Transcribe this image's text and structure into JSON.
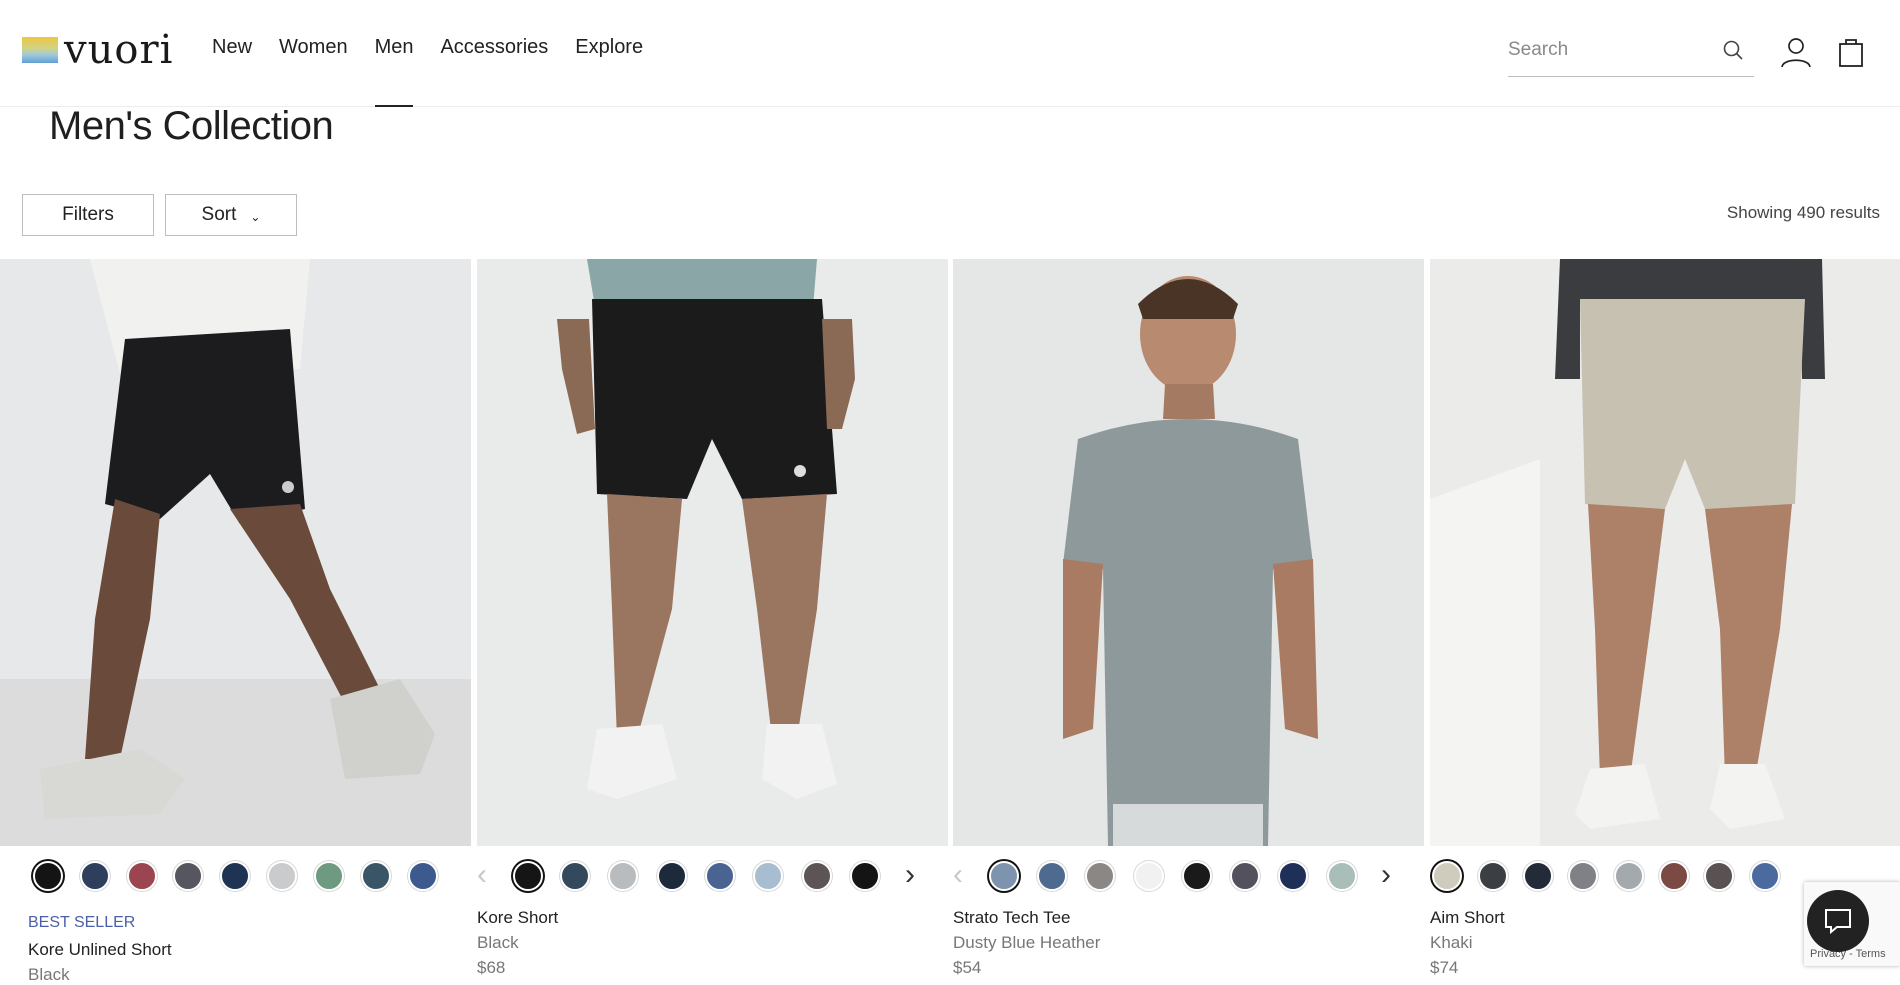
{
  "header": {
    "logo_text": "vuori",
    "nav": [
      "New",
      "Women",
      "Men",
      "Accessories",
      "Explore"
    ],
    "active_nav": "Men",
    "search_placeholder": "Search"
  },
  "page": {
    "title": "Men's Collection",
    "filters_label": "Filters",
    "sort_label": "Sort",
    "results_text": "Showing 490 results"
  },
  "products": [
    {
      "badge": "BEST SELLER",
      "name": "Kore Unlined Short",
      "color": "Black",
      "price": "",
      "swatches": [
        "#141414",
        "#2e3f5e",
        "#9a4550",
        "#55565f",
        "#1f3352",
        "#c9cbcc",
        "#6f9a82",
        "#3a5566",
        "#3c5a8e"
      ],
      "selected": 0
    },
    {
      "badge": "",
      "name": "Kore Short",
      "color": "Black",
      "price": "$68",
      "swatches": [
        "#151515",
        "#34495c",
        "#b9bcbf",
        "#1d2a3c",
        "#4a6491",
        "#a9bdd0",
        "#5d5555",
        "#141414"
      ],
      "selected": 0
    },
    {
      "badge": "",
      "name": "Strato Tech Tee",
      "color": "Dusty Blue Heather",
      "price": "$54",
      "swatches": [
        "#7e93ad",
        "#4f6a8f",
        "#8a8784",
        "#f1f1f1",
        "#1a1a1a",
        "#52515d",
        "#1e3058",
        "#a9bdb9"
      ],
      "selected": 0
    },
    {
      "badge": "",
      "name": "Aim Short",
      "color": "Khaki",
      "price": "$74",
      "swatches": [
        "#cfcbbd",
        "#3b3e42",
        "#242b38",
        "#7f8186",
        "#a4a9ad",
        "#7b4a42",
        "#5a5252",
        "#4a6aa0"
      ],
      "selected": 0
    }
  ],
  "recaptcha_text": "Privacy - Terms"
}
